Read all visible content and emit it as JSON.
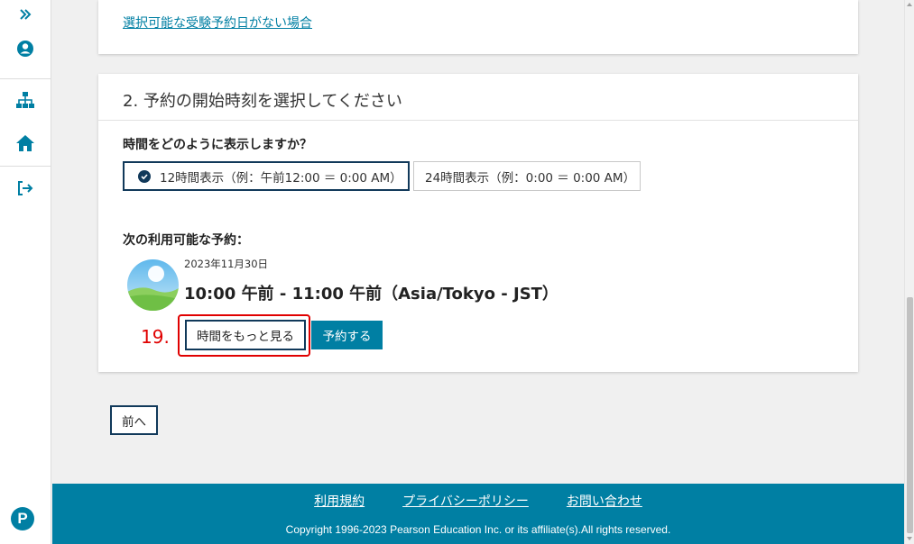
{
  "sidebar": {
    "icons": [
      "expand-icon",
      "user-icon",
      "sitemap-icon",
      "home-icon",
      "logout-icon"
    ],
    "logo_letter": "P"
  },
  "top_card": {
    "link": "選択可能な受験予約日がない場合"
  },
  "section": {
    "title": "2. 予約の開始時刻を選択してください",
    "question": "時間をどのように表示しますか？",
    "options": [
      {
        "label": "12時間表示（例：午前12:00 ＝ 0:00 AM）",
        "selected": true
      },
      {
        "label": "24時間表示（例：0:00 ＝ 0:00 AM）",
        "selected": false
      }
    ],
    "next_label": "次の利用可能な予約：",
    "slot": {
      "date": "2023年11月30日",
      "time": "10:00 午前 - 11:00 午前（Asia/Tokyo - JST）"
    },
    "annotation": "19.",
    "more_button": "時間をもっと見る",
    "book_button": "予約する"
  },
  "prev_button": "前へ",
  "footer": {
    "links": [
      "利用規約",
      "プライバシーポリシー",
      "お問い合わせ"
    ],
    "copyright": "Copyright 1996-2023 Pearson Education Inc. or its affiliate(s).All rights reserved."
  },
  "colors": {
    "accent": "#007fa3",
    "navy": "#11395a",
    "annotation": "#e00000"
  }
}
